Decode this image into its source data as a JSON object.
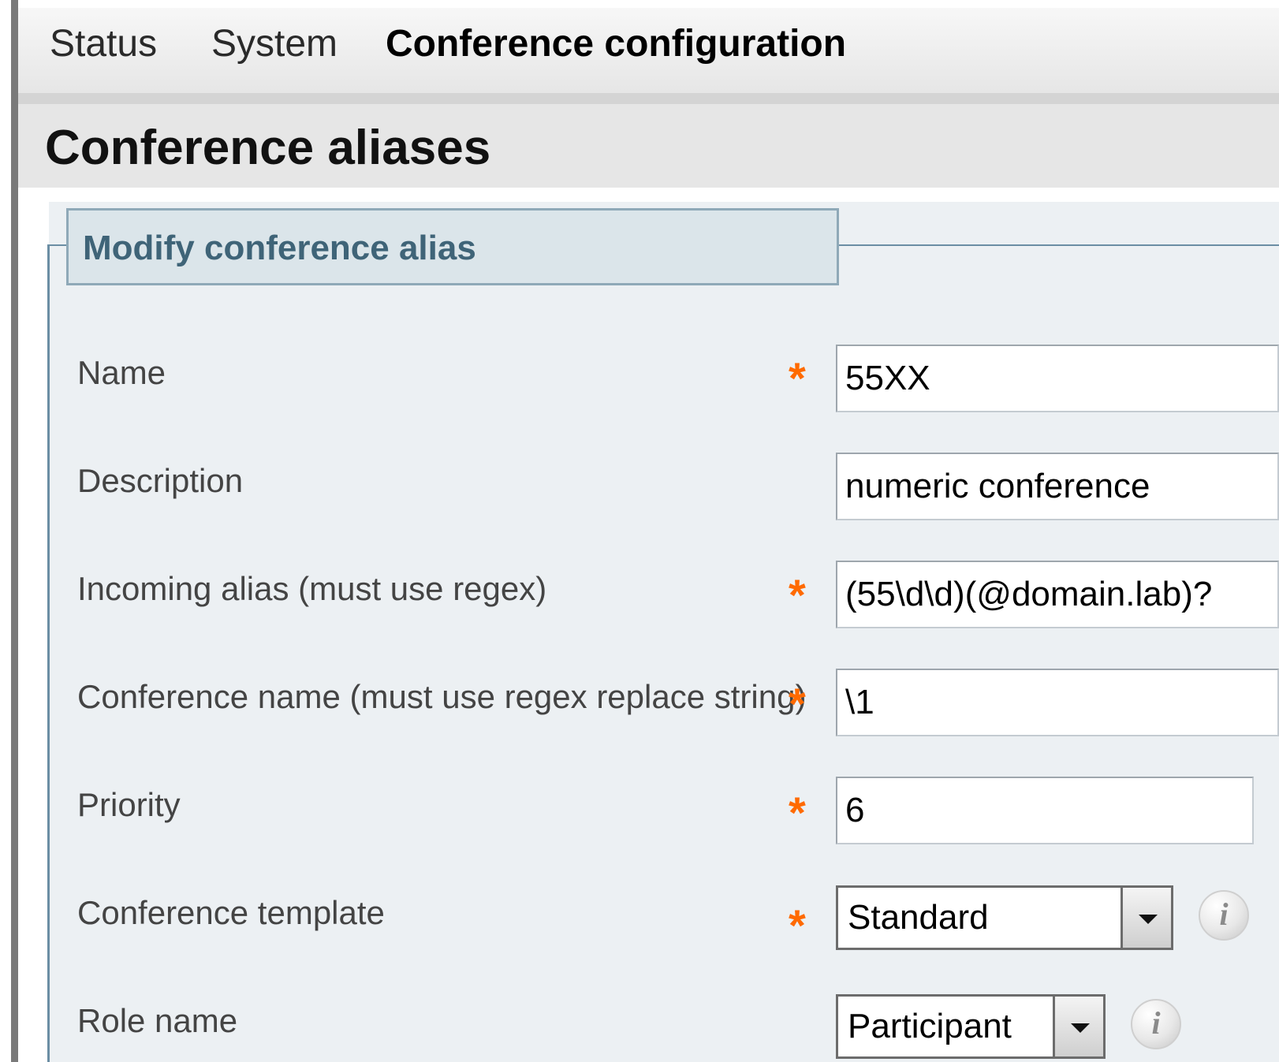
{
  "nav": {
    "tabs": [
      {
        "label": "Status"
      },
      {
        "label": "System"
      },
      {
        "label": "Conference configuration"
      }
    ],
    "active_tab": "Conference configuration"
  },
  "header": {
    "title": "Conference aliases"
  },
  "form": {
    "legend": "Modify conference alias",
    "required_marker": "*",
    "fields": [
      {
        "label": "Name",
        "value": "55XX",
        "required": true
      },
      {
        "label": "Description",
        "value": "numeric conference",
        "required": false
      },
      {
        "label": "Incoming alias (must use regex)",
        "value": "(55\\d\\d)(@domain.lab)?",
        "required": true
      },
      {
        "label": "Conference name (must use regex replace string)",
        "value": "\\1",
        "required": true
      },
      {
        "label": "Priority",
        "value": "6",
        "required": true
      },
      {
        "label": "Conference template",
        "value": "Standard",
        "required": true
      },
      {
        "label": "Role name",
        "value": "Participant",
        "required": false
      }
    ],
    "info_icon": "info-icon"
  },
  "colors": {
    "required_marker": "#ff6a00",
    "legend_text": "#3f6478",
    "panel_background": "#ecf0f3"
  }
}
